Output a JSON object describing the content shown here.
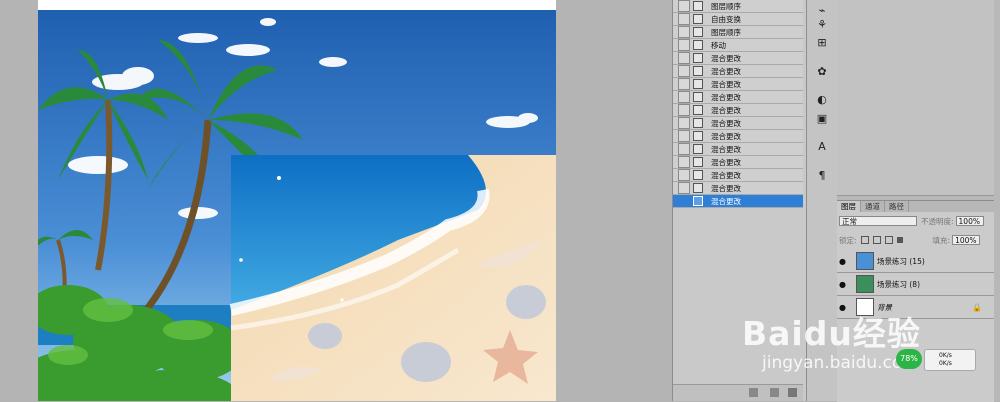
{
  "history": {
    "items": [
      {
        "label": "图层顺序",
        "icon": "document-icon"
      },
      {
        "label": "自由变换",
        "icon": "document-icon"
      },
      {
        "label": "图层顺序",
        "icon": "document-icon"
      },
      {
        "label": "移动",
        "icon": "move-icon"
      },
      {
        "label": "混合更改",
        "icon": "document-icon"
      },
      {
        "label": "混合更改",
        "icon": "document-icon"
      },
      {
        "label": "混合更改",
        "icon": "document-icon"
      },
      {
        "label": "混合更改",
        "icon": "document-icon"
      },
      {
        "label": "混合更改",
        "icon": "document-icon"
      },
      {
        "label": "混合更改",
        "icon": "document-icon"
      },
      {
        "label": "混合更改",
        "icon": "document-icon"
      },
      {
        "label": "混合更改",
        "icon": "document-icon"
      },
      {
        "label": "混合更改",
        "icon": "document-icon"
      },
      {
        "label": "混合更改",
        "icon": "document-icon"
      },
      {
        "label": "混合更改",
        "icon": "document-icon"
      },
      {
        "label": "混合更改",
        "icon": "document-icon",
        "active": true
      }
    ],
    "active_color": "#2f7fd6"
  },
  "layers": {
    "tabs": [
      "图层",
      "通道",
      "路径"
    ],
    "blend_mode": "正常",
    "opacity_label": "不透明度:",
    "opacity_value": "100%",
    "lock_label": "锁定:",
    "fill_label": "填充:",
    "fill_value": "100%",
    "items": [
      {
        "name": "场景练习 (15)"
      },
      {
        "name": "场景练习 (8)"
      },
      {
        "name": "背景"
      }
    ]
  },
  "watermark": {
    "logo": "Baidu经验",
    "url": "jingyan.baidu.com"
  },
  "speed_widget": {
    "percent": "78%",
    "up": "0K/s",
    "down": "0K/s"
  }
}
